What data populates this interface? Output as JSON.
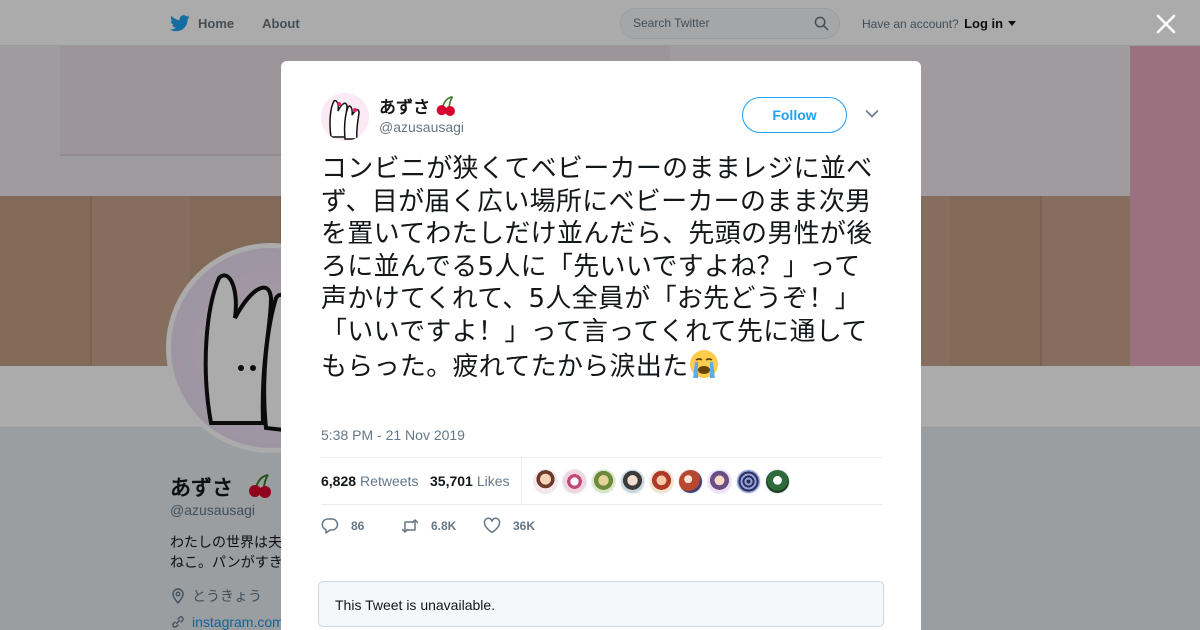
{
  "nav": {
    "home_label": "Home",
    "about_label": "About",
    "search_placeholder": "Search Twitter",
    "have_account_text": "Have an account?",
    "login_label": "Log in",
    "close_icon": "close-icon"
  },
  "profile": {
    "name": "あずさ",
    "handle": "@azusausagi",
    "bio": "わたしの世界は夫ねこ。パンがすき",
    "location": "とうきょう",
    "link": "instagram.com"
  },
  "tweet": {
    "author_name": "あずさ",
    "author_handle": "@azusausagi",
    "follow_label": "Follow",
    "text": "コンビニが狭くてベビーカーのままレジに並べず、目が届く広い場所にベビーカーのまま次男を置いてわたしだけ並んだら、先頭の男性が後ろに並んでる5人に「先いいですよね？」って声かけてくれて、5人全員が「お先どうぞ！」「いいですよ！」って言ってくれて先に通してもらった。疲れてたから涙出た",
    "timestamp": "5:38 PM - 21 Nov 2019",
    "retweets_count": "6,828",
    "retweets_label": "Retweets",
    "likes_count": "35,701",
    "likes_label": "Likes",
    "reply_count": "86",
    "retweet_action_count": "6.8K",
    "like_action_count": "36K",
    "unavailable_text": "This Tweet is unavailable."
  },
  "colors": {
    "accent": "#1da1f2",
    "text": "#14171a",
    "muted": "#657786"
  }
}
